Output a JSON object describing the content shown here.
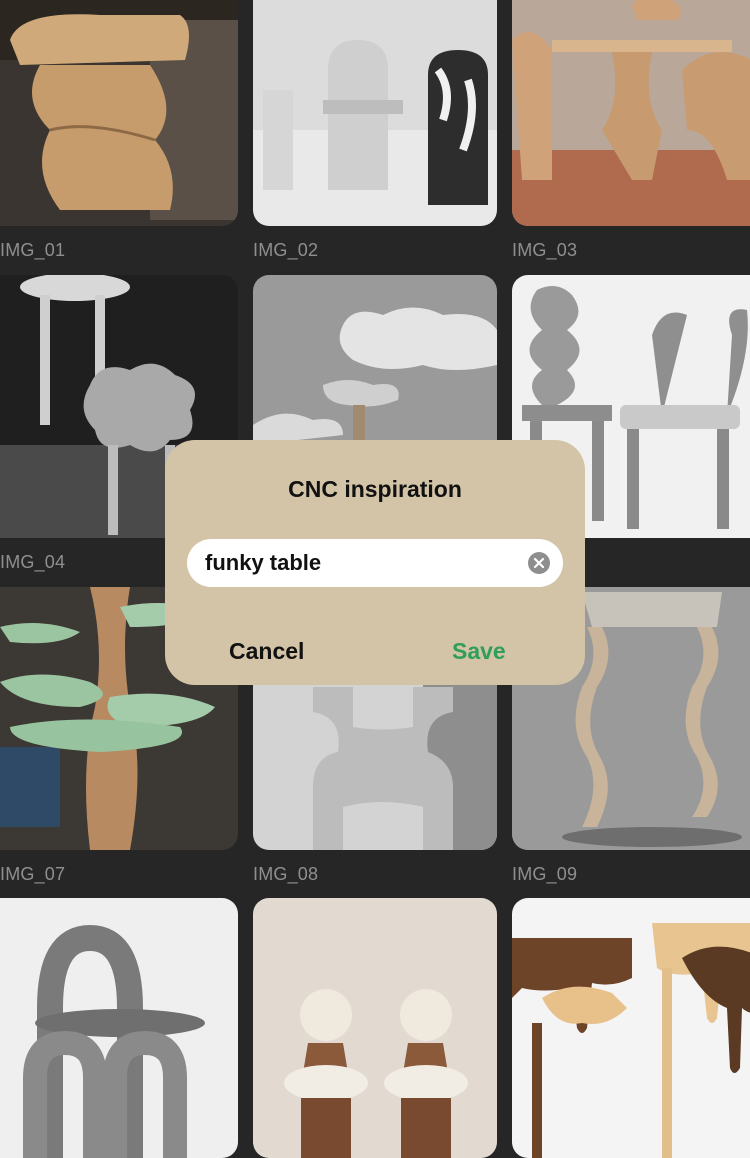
{
  "gallery": {
    "captions": [
      "IMG_01",
      "IMG_02",
      "IMG_03",
      "IMG_04",
      "IMG_07",
      "IMG_08",
      "IMG_09"
    ]
  },
  "dialog": {
    "title": "CNC inspiration",
    "input_value": "funky table",
    "cancel_label": "Cancel",
    "save_label": "Save",
    "save_color": "#2f9e5a",
    "background": "#d3c4a7"
  }
}
